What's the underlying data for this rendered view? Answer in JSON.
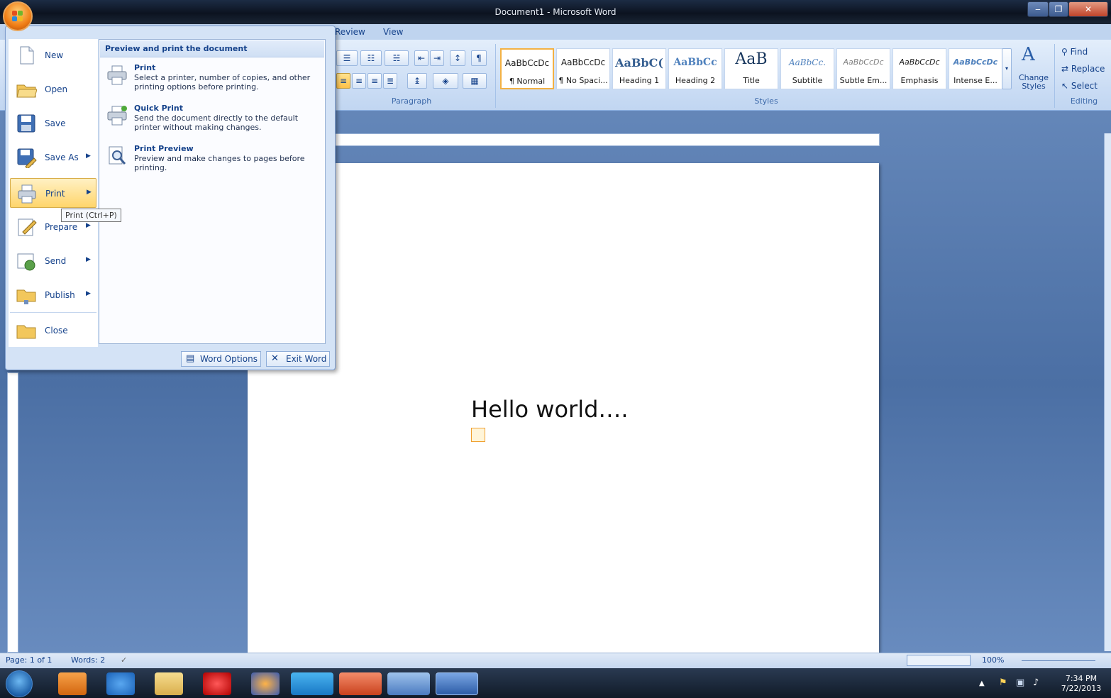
{
  "window": {
    "title": "Document1 - Microsoft Word",
    "min": "‒",
    "max": "❐",
    "close": "✕"
  },
  "ribbon": {
    "tabs": [
      "Review",
      "View"
    ],
    "paragraph_label": "Paragraph",
    "styles_label": "Styles",
    "editing_label": "Editing",
    "styles": [
      {
        "sample": "AaBbCcDc",
        "name": "¶ Normal"
      },
      {
        "sample": "AaBbCcDc",
        "name": "¶ No Spaci..."
      },
      {
        "sample": "AaBbC(",
        "name": "Heading 1"
      },
      {
        "sample": "AaBbCc",
        "name": "Heading 2"
      },
      {
        "sample": "AaB",
        "name": "Title"
      },
      {
        "sample": "AaBbCc.",
        "name": "Subtitle"
      },
      {
        "sample": "AaBbCcDc",
        "name": "Subtle Em..."
      },
      {
        "sample": "AaBbCcDc",
        "name": "Emphasis"
      },
      {
        "sample": "AaBbCcDc",
        "name": "Intense E..."
      }
    ],
    "change_styles": "Change Styles",
    "find": "Find",
    "replace": "Replace",
    "select": "Select"
  },
  "office_menu": {
    "items": [
      {
        "label": "New",
        "icon": "new-document-icon"
      },
      {
        "label": "Open",
        "icon": "open-folder-icon"
      },
      {
        "label": "Save",
        "icon": "save-disk-icon"
      },
      {
        "label": "Save As",
        "icon": "save-as-icon"
      },
      {
        "label": "Print",
        "icon": "printer-icon"
      },
      {
        "label": "Prepare",
        "icon": "prepare-icon"
      },
      {
        "label": "Send",
        "icon": "send-icon"
      },
      {
        "label": "Publish",
        "icon": "publish-icon"
      },
      {
        "label": "Close",
        "icon": "close-folder-icon"
      }
    ],
    "submenu_header": "Preview and print the document",
    "submenu": [
      {
        "title": "Print",
        "desc": "Select a printer, number of copies, and other printing options before printing."
      },
      {
        "title": "Quick Print",
        "desc": "Send the document directly to the default printer without making changes."
      },
      {
        "title": "Print Preview",
        "desc": "Preview and make changes to pages before printing."
      }
    ],
    "word_options": "Word Options",
    "exit_word": "Exit Word",
    "tooltip": "Print (Ctrl+P)"
  },
  "document": {
    "text": "Hello world…."
  },
  "statusbar": {
    "page": "Page: 1 of 1",
    "words": "Words: 2",
    "zoom": "100%"
  },
  "taskbar": {
    "time": "7:34 PM",
    "date": "7/22/2013"
  }
}
